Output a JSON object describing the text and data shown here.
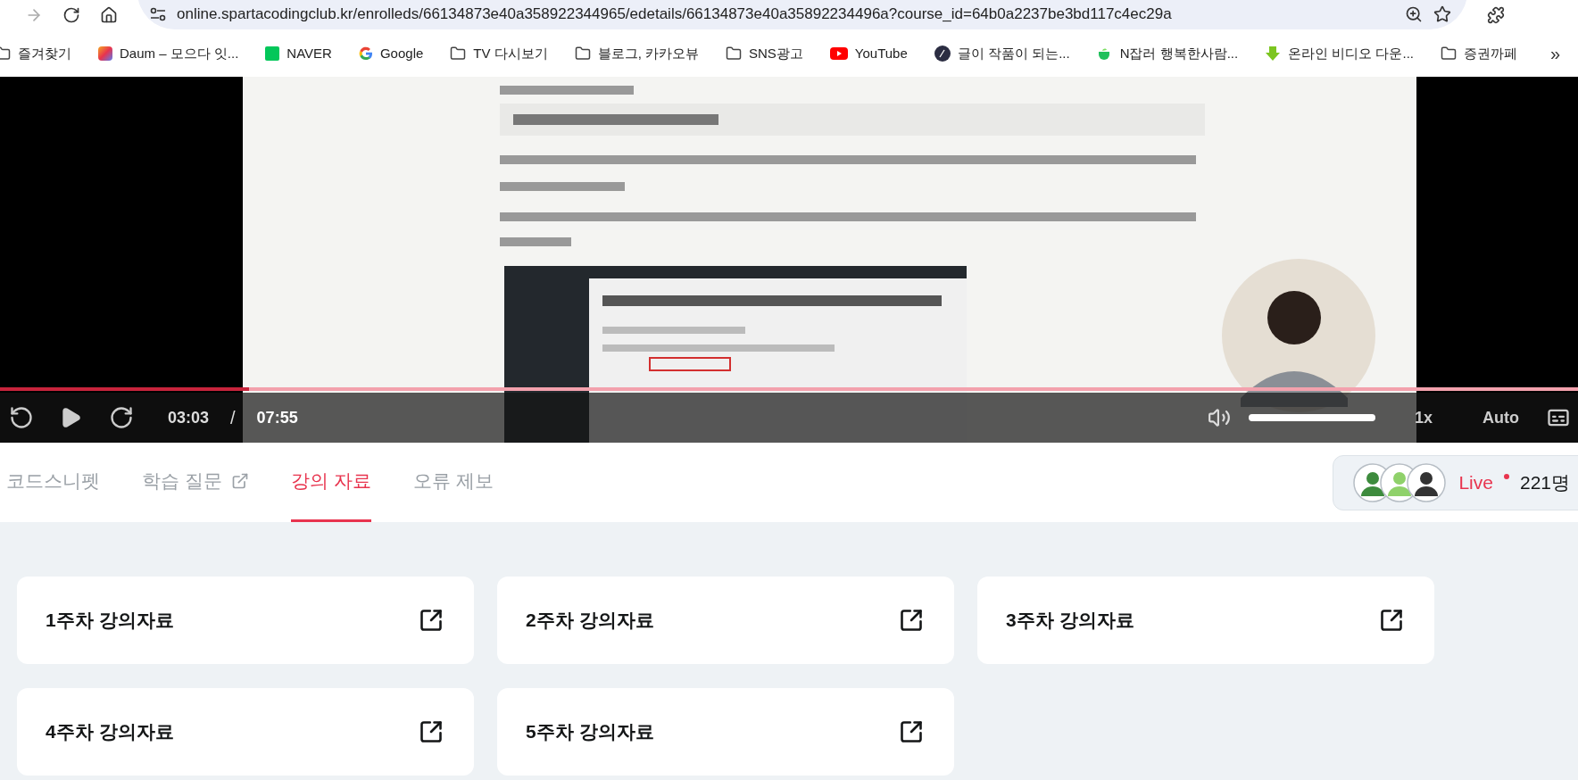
{
  "browser": {
    "url": "online.spartacodingclub.kr/enrolleds/66134873e40a358922344965/edetails/66134873e40a35892234496a?course_id=64b0a2237be3bd117c4ec29a",
    "bookmarks": [
      {
        "label": "즐겨찾기",
        "kind": "folder"
      },
      {
        "label": "Daum – 모으다 잇...",
        "kind": "daum"
      },
      {
        "label": "NAVER",
        "kind": "naver"
      },
      {
        "label": "Google",
        "kind": "google"
      },
      {
        "label": "TV 다시보기",
        "kind": "folder"
      },
      {
        "label": "블로그, 카카오뷰",
        "kind": "folder"
      },
      {
        "label": "SNS광고",
        "kind": "folder"
      },
      {
        "label": "YouTube",
        "kind": "youtube"
      },
      {
        "label": "글이 작품이 되는...",
        "kind": "pen"
      },
      {
        "label": "N잡러 행복한사람...",
        "kind": "cup"
      },
      {
        "label": "온라인 비디오 다운...",
        "kind": "download"
      },
      {
        "label": "증권까페",
        "kind": "folder"
      }
    ],
    "more": "»"
  },
  "video": {
    "progress": {
      "level": 0.158
    },
    "current_time": "03:03",
    "separator": "/",
    "total_time": "07:55",
    "volume": {
      "level": 1
    },
    "speed": "1x",
    "quality": "Auto"
  },
  "tabs": [
    {
      "label": "코드스니펫",
      "selected": false,
      "external": false
    },
    {
      "label": "학습 질문",
      "selected": false,
      "external": true
    },
    {
      "label": "강의 자료",
      "selected": true,
      "external": false
    },
    {
      "label": "오류 제보",
      "selected": false,
      "external": false
    }
  ],
  "live": {
    "label": "Live",
    "count": "221명"
  },
  "materials": [
    {
      "title": "1주차 강의자료"
    },
    {
      "title": "2주차 강의자료"
    },
    {
      "title": "3주차 강의자료"
    },
    {
      "title": "4주차 강의자료"
    },
    {
      "title": "5주차 강의자료"
    }
  ]
}
